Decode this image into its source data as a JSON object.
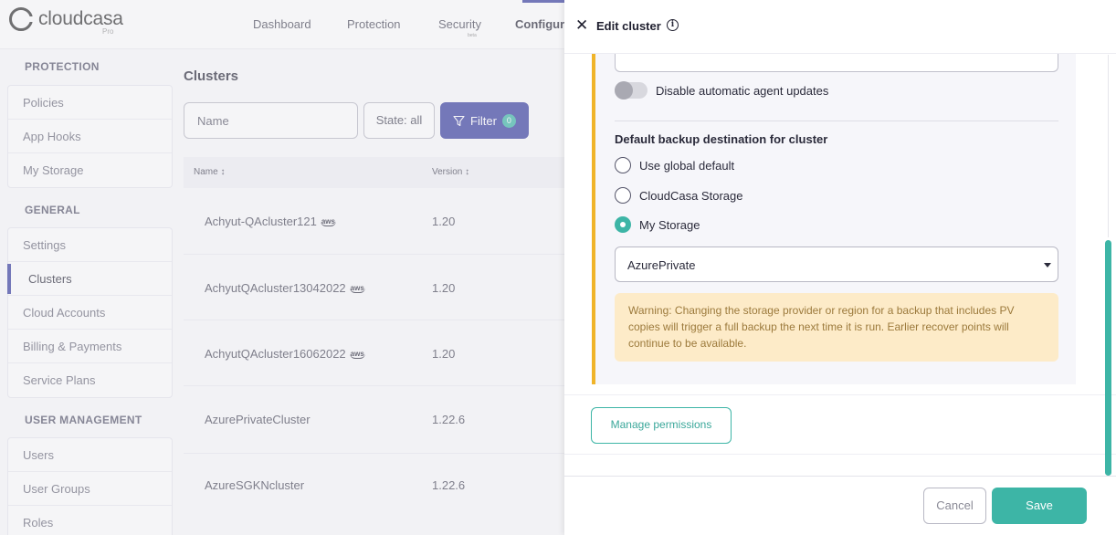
{
  "app": {
    "logo_text": "cloudcasa",
    "logo_sub": "Pro",
    "nav": [
      "Dashboard",
      "Protection",
      "Security",
      "Configur"
    ],
    "nav_badge": "beta"
  },
  "sidebar": {
    "protection_title": "PROTECTION",
    "protection_items": [
      "Policies",
      "App Hooks",
      "My Storage"
    ],
    "general_title": "GENERAL",
    "general_items": [
      "Settings",
      "Clusters",
      "Cloud Accounts",
      "Billing & Payments",
      "Service Plans"
    ],
    "user_title": "USER MANAGEMENT",
    "user_items": [
      "Users",
      "User Groups",
      "Roles"
    ]
  },
  "main": {
    "title": "Clusters",
    "search_placeholder": "Name",
    "state_label": "State: all",
    "filter_label": "Filter",
    "filter_count": "0",
    "columns": [
      "Name ↕",
      "Version ↕"
    ],
    "rows": [
      {
        "name": "Achyut-QAcluster121",
        "aws": "aws",
        "version": "1.20"
      },
      {
        "name": "AchyutQAcluster13042022",
        "aws": "aws",
        "version": "1.20"
      },
      {
        "name": "AchyutQAcluster16062022",
        "aws": "aws",
        "version": "1.20"
      },
      {
        "name": "AzurePrivateCluster",
        "aws": "",
        "version": "1.22.6"
      },
      {
        "name": "AzureSGKNcluster",
        "aws": "",
        "version": "1.22.6"
      }
    ]
  },
  "drawer": {
    "close": "✕",
    "title": "Edit cluster",
    "info": "i",
    "toggle_label": "Disable automatic agent updates",
    "section_title": "Default backup destination for cluster",
    "options": [
      "Use global default",
      "CloudCasa Storage",
      "My Storage"
    ],
    "selected_option": "My Storage",
    "storage_value": "AzurePrivate",
    "warning": "Warning: Changing the storage provider or region for a backup that includes PV copies will trigger a full backup the next time it is run. Earlier recover points will continue to be available.",
    "manage_permissions": "Manage permissions",
    "cancel": "Cancel",
    "save": "Save"
  },
  "colors": {
    "primary": "#3a3fa0",
    "accent": "#3db5a6",
    "warning_bg": "#fdebc8",
    "highlight": "#f0b429"
  }
}
